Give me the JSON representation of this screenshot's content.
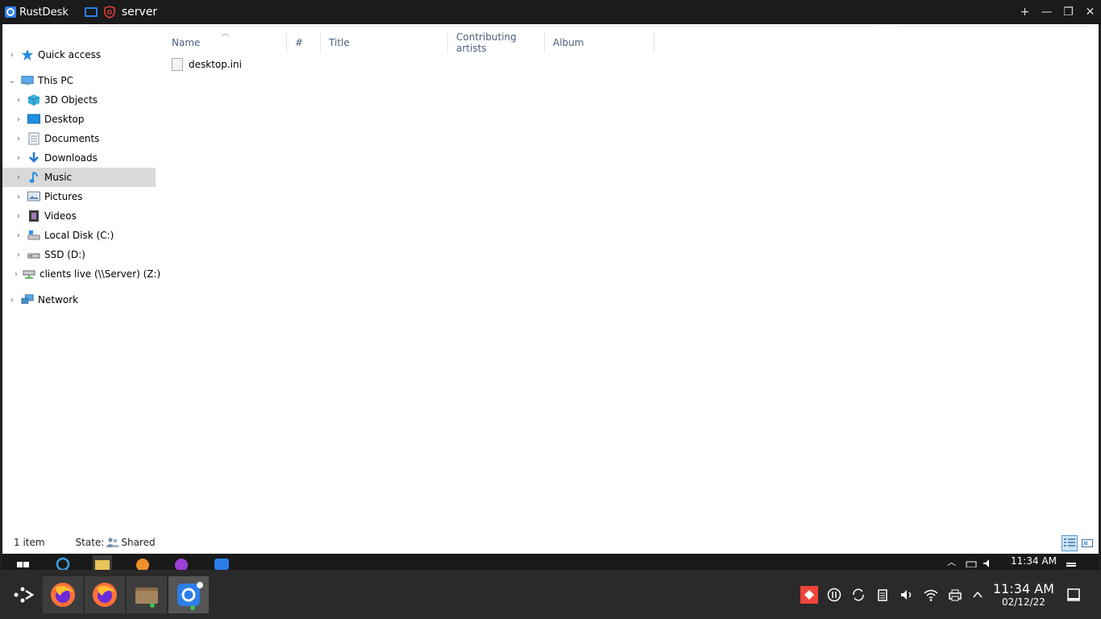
{
  "rustdesk": {
    "app_title": "RustDesk",
    "tab_name": "server",
    "controls": {
      "add": "+",
      "minimize": "—",
      "restore": "❐",
      "close": "✕"
    }
  },
  "explorer": {
    "nav": [
      {
        "label": "Quick access",
        "icon": "star-icon",
        "indent": 0,
        "chev": "›",
        "selected": false
      },
      {
        "label": "This PC",
        "icon": "computer-icon",
        "indent": 0,
        "chev": "⌄",
        "selected": false
      },
      {
        "label": "3D Objects",
        "icon": "cube-icon",
        "indent": 1,
        "chev": "›",
        "selected": false
      },
      {
        "label": "Desktop",
        "icon": "desktop-icon",
        "indent": 1,
        "chev": "›",
        "selected": false
      },
      {
        "label": "Documents",
        "icon": "document-icon",
        "indent": 1,
        "chev": "›",
        "selected": false
      },
      {
        "label": "Downloads",
        "icon": "download-icon",
        "indent": 1,
        "chev": "›",
        "selected": false
      },
      {
        "label": "Music",
        "icon": "music-icon",
        "indent": 1,
        "chev": "›",
        "selected": true
      },
      {
        "label": "Pictures",
        "icon": "picture-icon",
        "indent": 1,
        "chev": "›",
        "selected": false
      },
      {
        "label": "Videos",
        "icon": "video-icon",
        "indent": 1,
        "chev": "›",
        "selected": false
      },
      {
        "label": "Local Disk (C:)",
        "icon": "disk-icon",
        "indent": 1,
        "chev": "›",
        "selected": false
      },
      {
        "label": "SSD (D:)",
        "icon": "drive-icon",
        "indent": 1,
        "chev": "›",
        "selected": false
      },
      {
        "label": "clients live (\\\\Server) (Z:)",
        "icon": "network-drive-icon",
        "indent": 1,
        "chev": "›",
        "selected": false
      },
      {
        "label": "Network",
        "icon": "network-icon",
        "indent": 0,
        "chev": "›",
        "selected": false
      }
    ],
    "columns": {
      "name": "Name",
      "number": "#",
      "title": "Title",
      "contributing_artists": "Contributing artists",
      "album": "Album"
    },
    "files": [
      {
        "name": "desktop.ini"
      }
    ],
    "status": {
      "count": "1 item",
      "state_label": "State:",
      "state_value": "Shared"
    }
  },
  "remote_taskbar": {
    "time": "11:34 AM"
  },
  "host_taskbar": {
    "time": "11:34 AM",
    "date": "02/12/22"
  },
  "colors": {
    "accent": "#2b7de9",
    "selection": "#d9d9d9",
    "header_text": "#4c607a"
  }
}
